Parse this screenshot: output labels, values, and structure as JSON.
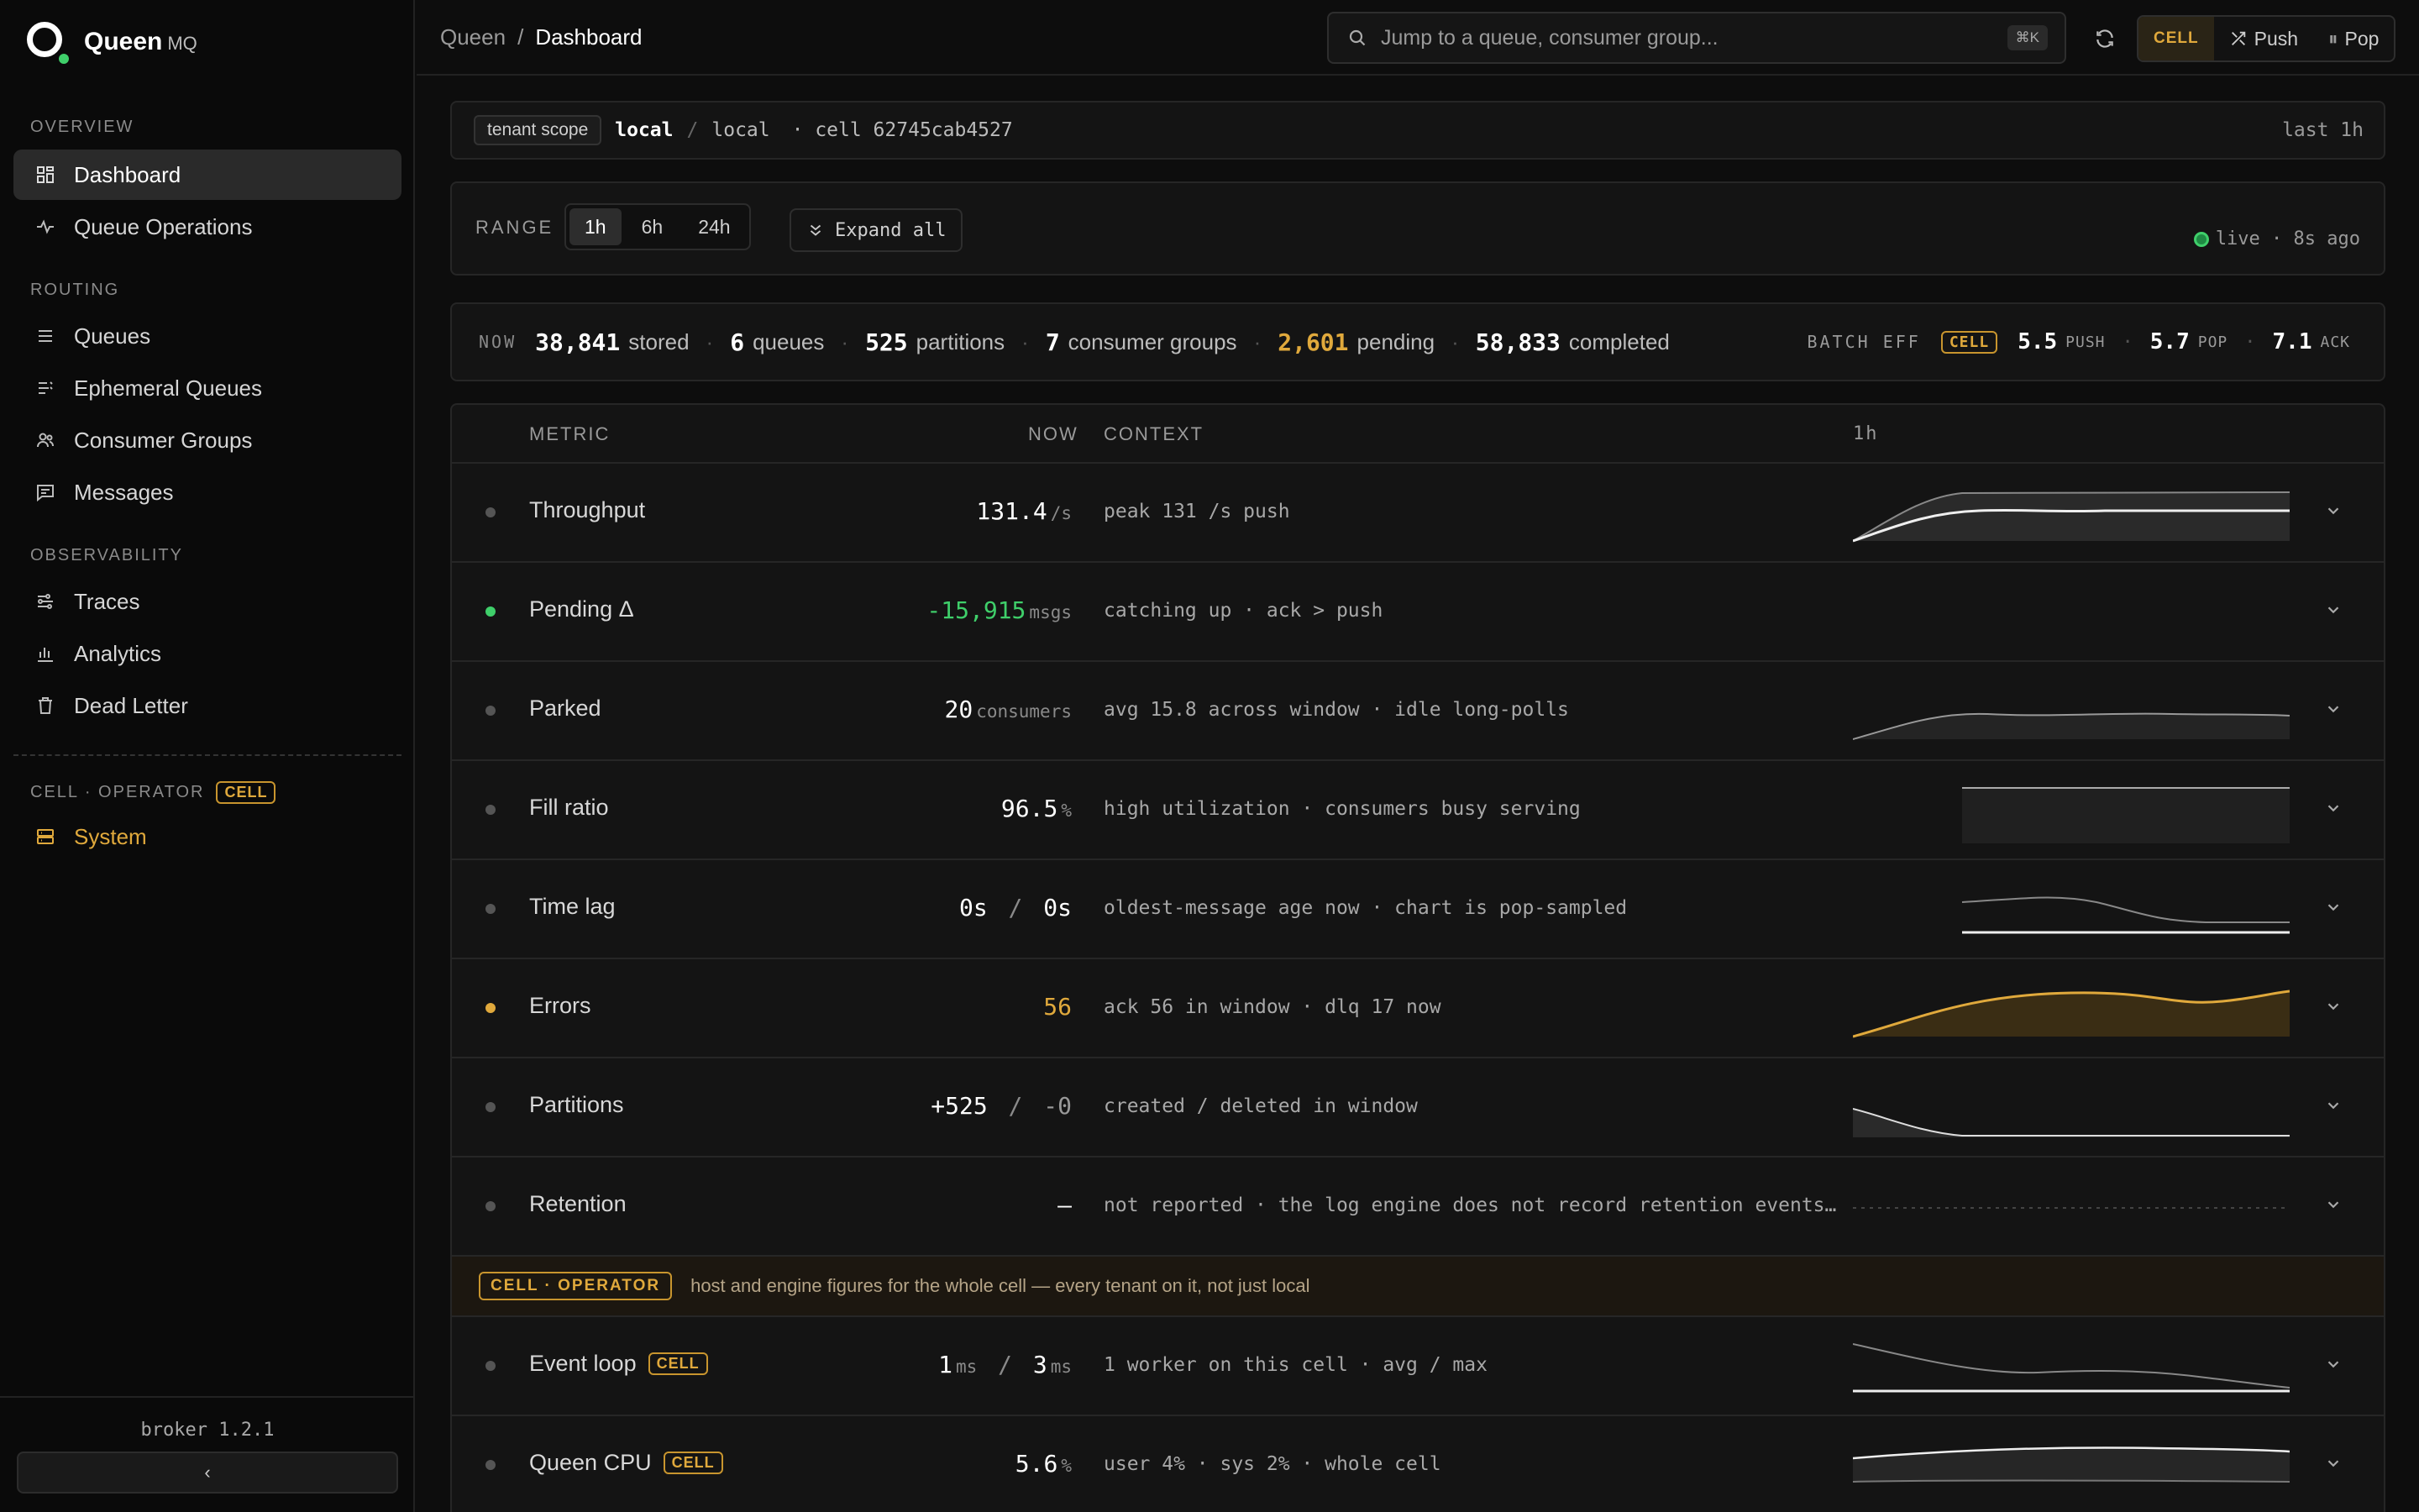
{
  "brand": {
    "name": "Queen",
    "sub": "MQ"
  },
  "sidebar": {
    "sections": [
      {
        "title": "OVERVIEW",
        "items": [
          {
            "label": "Dashboard",
            "icon": "grid-icon",
            "active": true
          },
          {
            "label": "Queue Operations",
            "icon": "pulse-icon"
          }
        ]
      },
      {
        "title": "ROUTING",
        "items": [
          {
            "label": "Queues",
            "icon": "list-icon"
          },
          {
            "label": "Ephemeral Queues",
            "icon": "list-fade-icon"
          },
          {
            "label": "Consumer Groups",
            "icon": "users-icon"
          },
          {
            "label": "Messages",
            "icon": "message-icon"
          }
        ]
      },
      {
        "title": "OBSERVABILITY",
        "items": [
          {
            "label": "Traces",
            "icon": "trace-icon"
          },
          {
            "label": "Analytics",
            "icon": "bar-chart-icon"
          },
          {
            "label": "Dead Letter",
            "icon": "trash-icon"
          }
        ]
      }
    ],
    "cell_section": {
      "title": "CELL · OPERATOR",
      "badge": "CELL",
      "item": "System"
    },
    "version": "broker 1.2.1",
    "collapse_label": "‹"
  },
  "header": {
    "crumb_root": "Queen",
    "crumb_sep": "/",
    "crumb_current": "Dashboard",
    "search_placeholder": "Jump to a queue, consumer group...",
    "search_kbd": "⌘K",
    "mode_cell": "CELL",
    "mode_push": "Push",
    "mode_pop": "Pop"
  },
  "tenant": {
    "scope": "tenant scope",
    "name": "local",
    "sep": "/",
    "sub": "local",
    "cell": "· cell 62745cab4527",
    "window": "last 1h"
  },
  "range": {
    "label": "RANGE",
    "options": [
      "1h",
      "6h",
      "24h"
    ],
    "selected": "1h",
    "expand": "Expand all",
    "live": "live · 8s ago"
  },
  "now": {
    "tag": "NOW",
    "stats": [
      {
        "value": "38,841",
        "label": "stored"
      },
      {
        "value": "6",
        "label": "queues"
      },
      {
        "value": "525",
        "label": "partitions"
      },
      {
        "value": "7",
        "label": "consumer groups"
      },
      {
        "value": "2,601",
        "label": "pending",
        "accent": "#e0a93c"
      },
      {
        "value": "58,833",
        "label": "completed"
      }
    ],
    "batch_label": "BATCH EFF",
    "batch_badge": "CELL",
    "batch": [
      {
        "value": "5.5",
        "unit": "PUSH"
      },
      {
        "value": "5.7",
        "unit": "POP"
      },
      {
        "value": "7.1",
        "unit": "ACK"
      }
    ]
  },
  "table": {
    "headers": {
      "metric": "METRIC",
      "now": "NOW",
      "context": "CONTEXT",
      "window": "1h"
    },
    "rows": [
      {
        "metric": "Throughput",
        "value": "131.4",
        "unit": "/s",
        "context": "peak 131 /s push",
        "status": "neutral"
      },
      {
        "metric": "Pending Δ",
        "value": "-15,915",
        "unit": "msgs",
        "context": "catching up · ack > push",
        "status": "green"
      },
      {
        "metric": "Parked",
        "value": "20",
        "unit": "consumers",
        "context": "avg 15.8 across window · idle long-polls",
        "status": "neutral"
      },
      {
        "metric": "Fill ratio",
        "value": "96.5",
        "unit": "%",
        "context": "high utilization · consumers busy serving",
        "status": "neutral"
      },
      {
        "metric": "Time lag",
        "value": "0s",
        "value2": "0s",
        "context": "oldest-message age now · chart is pop-sampled",
        "status": "neutral"
      },
      {
        "metric": "Errors",
        "value": "56",
        "context": "ack 56 in window · dlq 17 now",
        "status": "amber"
      },
      {
        "metric": "Partitions",
        "value": "+525",
        "value2": "-0",
        "context": "created / deleted in window",
        "status": "neutral"
      },
      {
        "metric": "Retention",
        "value": "—",
        "context": "not reported · the log engine does not record retention events…",
        "status": "neutral"
      }
    ],
    "banner": {
      "badge": "CELL · OPERATOR",
      "text": "host and engine figures for the whole cell — every tenant on it, not just local"
    },
    "cell_rows": [
      {
        "metric": "Event loop",
        "badge": "CELL",
        "value": "1",
        "unit": "ms",
        "value2": "3",
        "unit2": "ms",
        "context": "1 worker on this cell · avg / max"
      },
      {
        "metric": "Queen CPU",
        "badge": "CELL",
        "value": "5.6",
        "unit": "%",
        "context": "user 4% · sys 2% · whole cell"
      }
    ]
  },
  "colors": {
    "accent": "#e0a93c",
    "green": "#3fcf6a",
    "bg": "#0d0d0d"
  }
}
